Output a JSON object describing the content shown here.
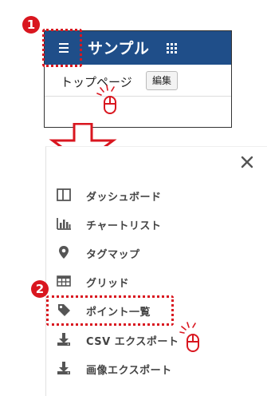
{
  "steps": {
    "step1": "1",
    "step2": "2"
  },
  "app": {
    "title": "サンプル",
    "breadcrumb": "トップページ",
    "edit_label": "編集",
    "header_color": "#1f4e89"
  },
  "menu": {
    "close_label": "×",
    "items": [
      {
        "label": "ダッシュボード",
        "icon": "dashboard-icon"
      },
      {
        "label": "チャートリスト",
        "icon": "bar-chart-icon"
      },
      {
        "label": "タグマップ",
        "icon": "map-marker-icon"
      },
      {
        "label": "グリッド",
        "icon": "table-icon"
      },
      {
        "label": "ポイント一覧",
        "icon": "tag-icon"
      },
      {
        "label": "CSV エクスポート",
        "icon": "download-icon"
      },
      {
        "label": "画像エクスポート",
        "icon": "download-icon"
      }
    ]
  },
  "colors": {
    "accent": "#d9161f",
    "menu_text": "#444444",
    "icon": "#555555"
  }
}
